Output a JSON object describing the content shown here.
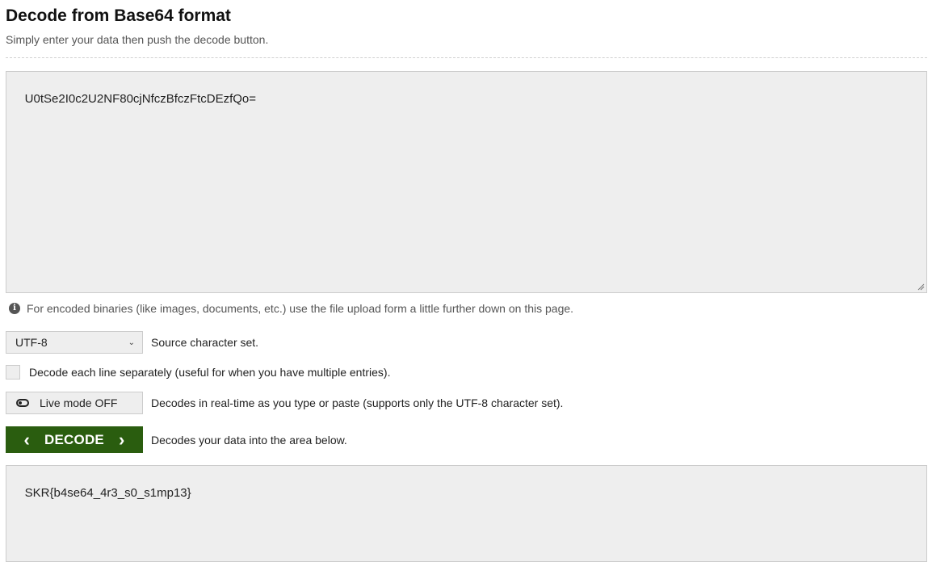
{
  "header": {
    "title": "Decode from Base64 format",
    "subtitle": "Simply enter your data then push the decode button."
  },
  "input": {
    "value": "U0tSe2I0c2U2NF80cjNfczBfczFtcDEzfQo="
  },
  "info": {
    "text": "For encoded binaries (like images, documents, etc.) use the file upload form a little further down on this page."
  },
  "charset": {
    "selected": "UTF-8",
    "label": "Source character set."
  },
  "line_option": {
    "label": "Decode each line separately (useful for when you have multiple entries).",
    "checked": false
  },
  "live_mode": {
    "button_label": "Live mode OFF",
    "description": "Decodes in real-time as you type or paste (supports only the UTF-8 character set)."
  },
  "decode": {
    "button_label": "DECODE",
    "description": "Decodes your data into the area below.",
    "color": "#2a5d0f"
  },
  "output": {
    "value": "SKR{b4se64_4r3_s0_s1mp13}"
  }
}
